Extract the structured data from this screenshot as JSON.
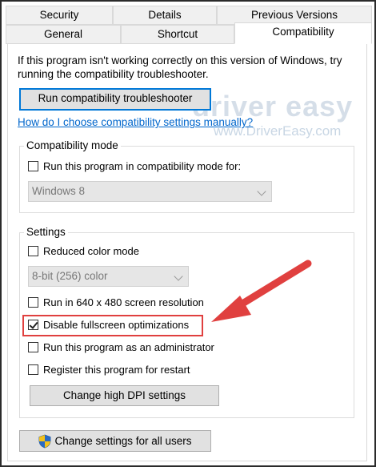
{
  "tabs_row1": [
    "Security",
    "Details",
    "Previous Versions"
  ],
  "tabs_row2": [
    "General",
    "Shortcut",
    "Compatibility"
  ],
  "intro_text_line1": "If this program isn't working correctly on this version of Windows, try",
  "intro_text_line2": "running the compatibility troubleshooter.",
  "run_troubleshooter_label": "Run compatibility troubleshooter",
  "manual_link": "How do I choose compatibility settings manually?",
  "watermark": {
    "brand": "driver easy",
    "url": "www.DriverEasy.com"
  },
  "compat_mode": {
    "legend": "Compatibility mode",
    "checkbox_label": "Run this program in compatibility mode for:",
    "checked": false,
    "select_value": "Windows 8"
  },
  "settings": {
    "legend": "Settings",
    "reduced_color": {
      "label": "Reduced color mode",
      "checked": false
    },
    "color_select_value": "8-bit (256) color",
    "res_640": {
      "label": "Run in 640 x 480 screen resolution",
      "checked": false
    },
    "disable_fullscreen": {
      "label": "Disable fullscreen optimizations",
      "checked": true
    },
    "run_admin": {
      "label": "Run this program as an administrator",
      "checked": false
    },
    "register_restart": {
      "label": "Register this program for restart",
      "checked": false
    },
    "dpi_button": "Change high DPI settings"
  },
  "all_users_button": "Change settings for all users",
  "colors": {
    "highlight": "#e0403f",
    "link": "#0066cc",
    "focus": "#0078d7"
  }
}
